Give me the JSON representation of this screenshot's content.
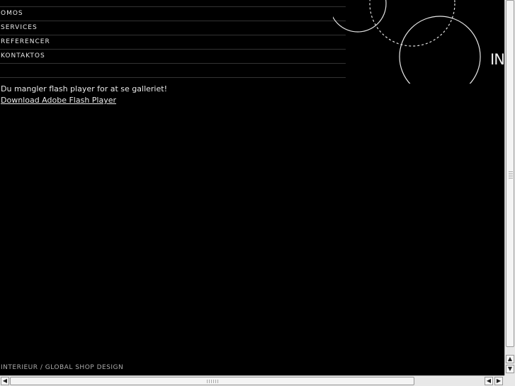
{
  "nav": {
    "items": [
      {
        "label": "OMOS"
      },
      {
        "label": "SERVICES"
      },
      {
        "label": "REFERENCER"
      },
      {
        "label": "KONTAKTOS"
      },
      {
        "label": ""
      }
    ]
  },
  "logo": {
    "text": "IN"
  },
  "flash": {
    "message": "Du mangler flash player for at se galleriet!",
    "link_label": "Download Adobe Flash Player"
  },
  "footer": {
    "text": "INTERIEUR / GLOBAL SHOP DESIGN"
  },
  "icons": {
    "scroll_up": "▲",
    "scroll_down": "▼",
    "scroll_left": "◀",
    "scroll_right": "▶"
  },
  "colors": {
    "background": "#000000",
    "text": "#e8e8e8",
    "divider": "#333333"
  }
}
